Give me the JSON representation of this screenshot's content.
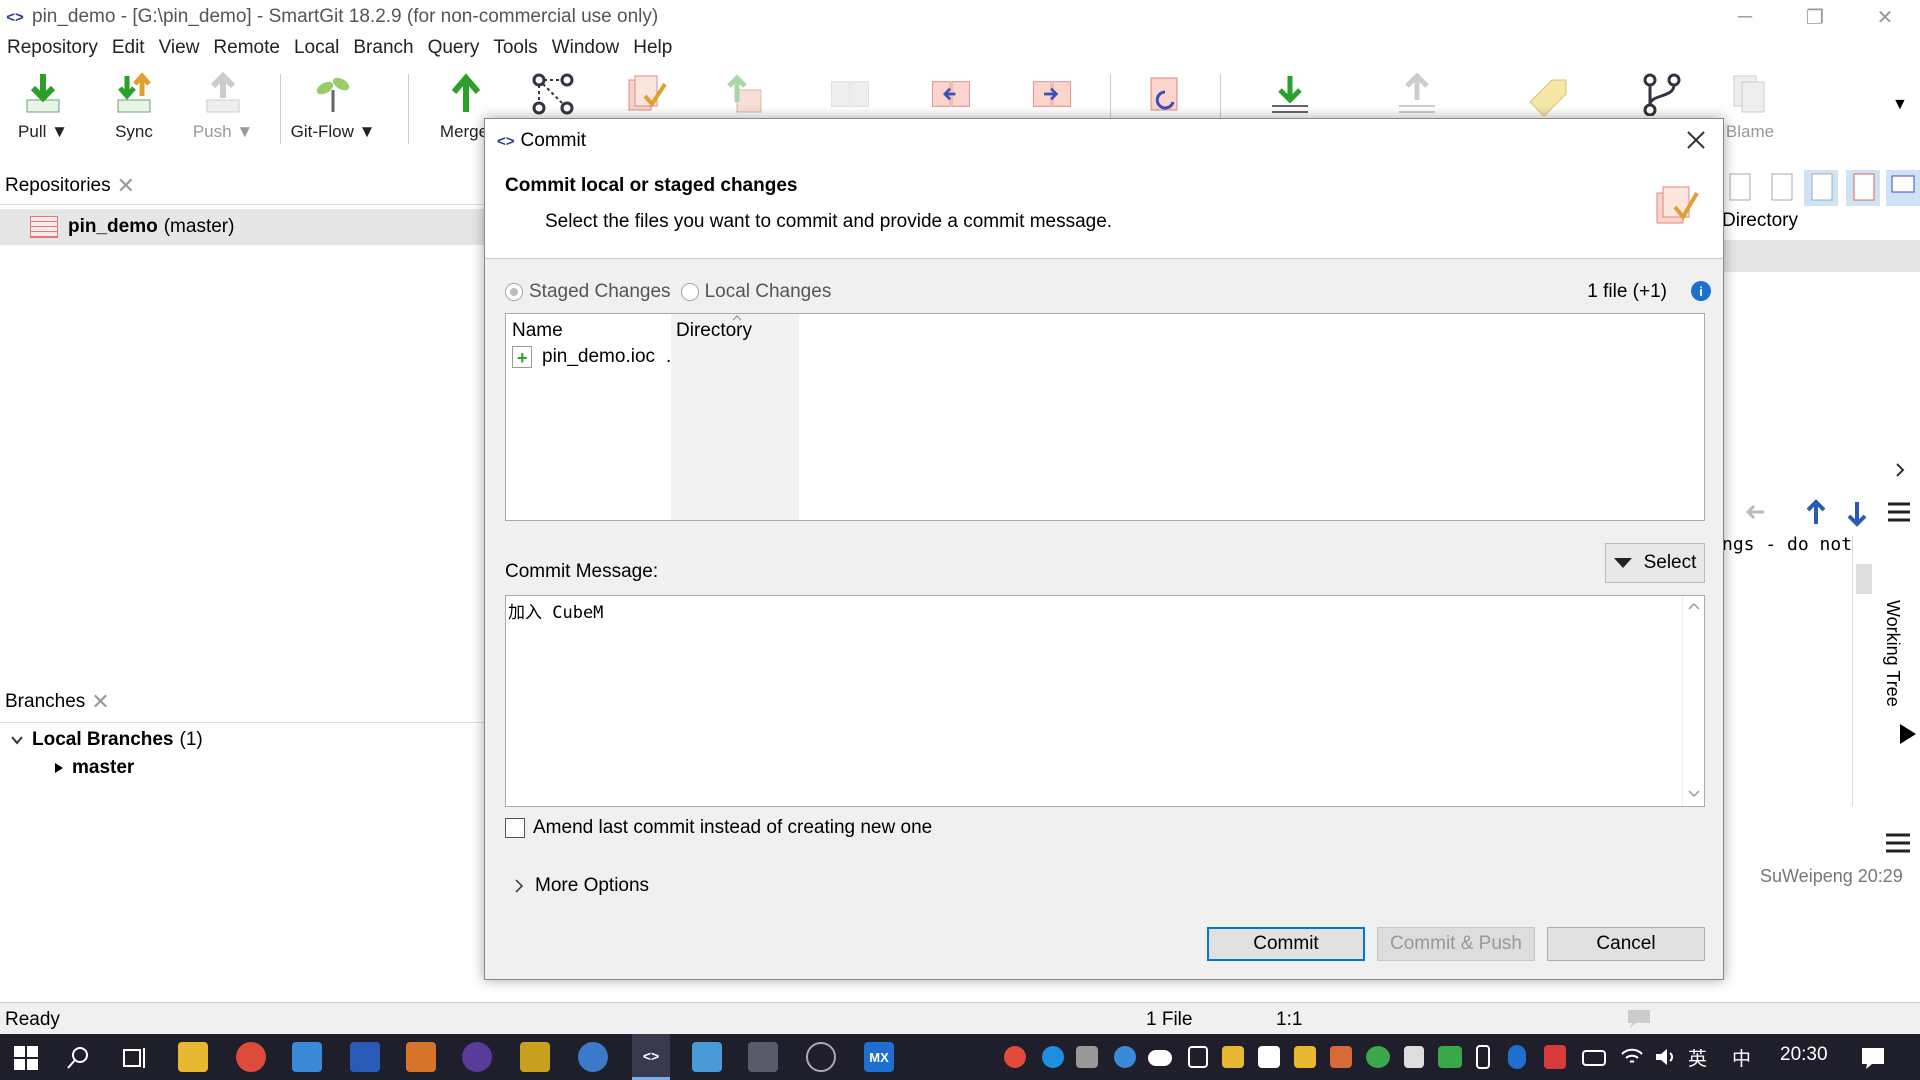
{
  "window": {
    "title": "pin_demo - [G:\\pin_demo] - SmartGit 18.2.9 (for non-commercial use only)",
    "app_icon": "<>",
    "minimize": "─",
    "restore": "❐",
    "close": "✕"
  },
  "menu": [
    "Repository",
    "Edit",
    "View",
    "Remote",
    "Local",
    "Branch",
    "Query",
    "Tools",
    "Window",
    "Help"
  ],
  "toolbar": {
    "pull": "Pull ▼",
    "sync": "Sync",
    "push": "Push ▼",
    "gitflow": "Git-Flow ▼",
    "merge": "Merge",
    "blame": "Blame",
    "overflow": "▼"
  },
  "repositories": {
    "header": "Repositories",
    "close": "✕",
    "repo_name": "pin_demo",
    "repo_branch": "(master)"
  },
  "branches": {
    "header": "Branches",
    "close": "✕",
    "local_branches": "Local Branches",
    "local_count": "(1)",
    "master": "master"
  },
  "background": {
    "directory_header": "Directory",
    "code_snippet": "ngs - do not",
    "user_time": "SuWeipeng 20:29",
    "working_tree": "Working Tree"
  },
  "status": {
    "ready": "Ready",
    "files": "1 File",
    "position": "1:1"
  },
  "taskbar": {
    "ime": "英",
    "ime2": "中",
    "time": "20:30"
  },
  "dialog": {
    "title": "Commit",
    "heading": "Commit local or staged changes",
    "subheading": "Select the files you want to commit and provide a commit message.",
    "staged_label": "Staged Changes",
    "local_label": "Local Changes",
    "file_count": "1 file (+1)",
    "col_name": "Name",
    "col_directory": "Directory",
    "file_name": "pin_demo.ioc",
    "file_dir": ".",
    "message_label": "Commit Message:",
    "select_label": "Select",
    "message_text": "加入 CubeM",
    "amend_label": "Amend last commit instead of creating new one",
    "more_options": "More Options",
    "commit_btn": "Commit",
    "commit_push_btn": "Commit & Push",
    "cancel_btn": "Cancel"
  },
  "colors": {
    "accent": "#0078d7",
    "taskbar": "#1f1f2b",
    "pull_green": "#2aa02a"
  }
}
